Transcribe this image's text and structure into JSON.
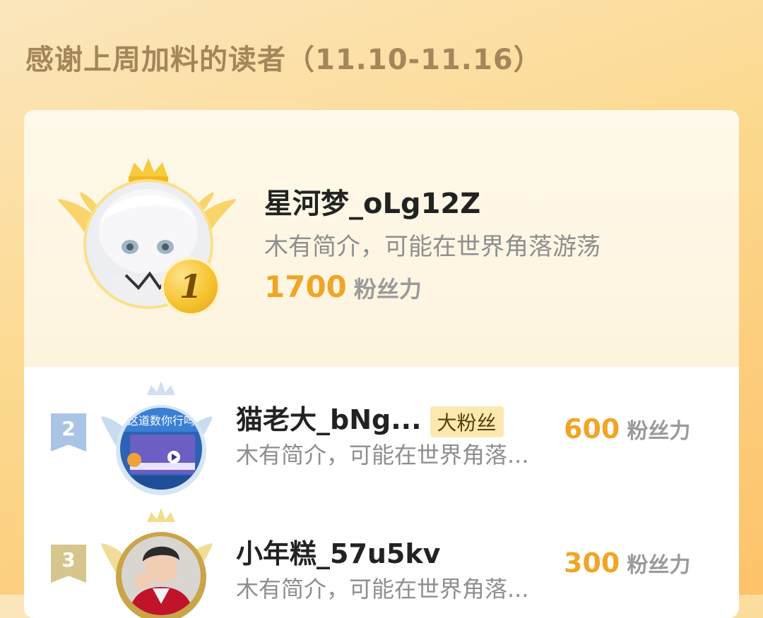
{
  "page": {
    "title": "感谢上周加料的读者（11.10-11.16）"
  },
  "stat_unit": "粉丝力",
  "top_reader": {
    "rank": "1",
    "name": "星河梦_oLg12Z",
    "bio": "木有简介，可能在世界角落游荡",
    "points": "1700"
  },
  "readers": [
    {
      "rank": "2",
      "name": "猫老大_bNg...",
      "badge": "大粉丝",
      "bio": "木有简介，可能在世界角落...",
      "points": "600"
    },
    {
      "rank": "3",
      "name": "小年糕_57u5kv",
      "bio": "木有简介，可能在世界角落...",
      "points": "300"
    }
  ],
  "colors": {
    "gold": "#f0a526",
    "silver_flag": "#a9c4e4",
    "bronze_flag": "#d6c68d",
    "title": "#a3865a"
  }
}
